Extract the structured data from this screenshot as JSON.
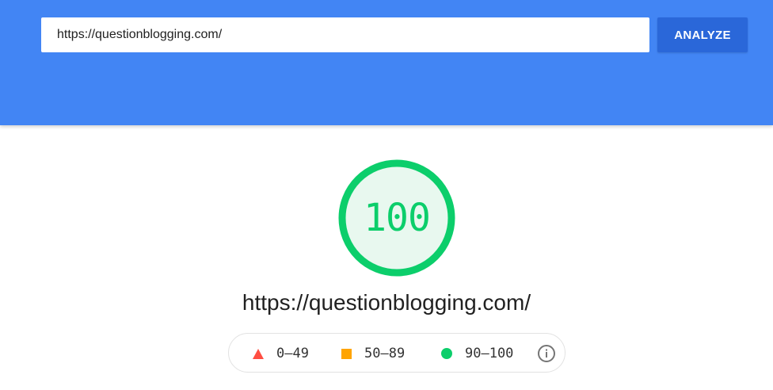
{
  "search": {
    "url_value": "https://questionblogging.com/",
    "analyze_label": "ANALYZE"
  },
  "report": {
    "score": "100",
    "score_fraction": 1.0,
    "url": "https://questionblogging.com/"
  },
  "legend": {
    "items": [
      {
        "range": "0–49",
        "icon": "triangle-fail-icon",
        "color": "#ff4e42"
      },
      {
        "range": "50–89",
        "icon": "square-average-icon",
        "color": "#ffa400"
      },
      {
        "range": "90–100",
        "icon": "circle-pass-icon",
        "color": "#0cce6b"
      }
    ],
    "info_icon": "info-icon"
  },
  "colors": {
    "header_bg": "#4285f4",
    "button_bg": "#2a67d9",
    "pass_green": "#0cce6b"
  }
}
